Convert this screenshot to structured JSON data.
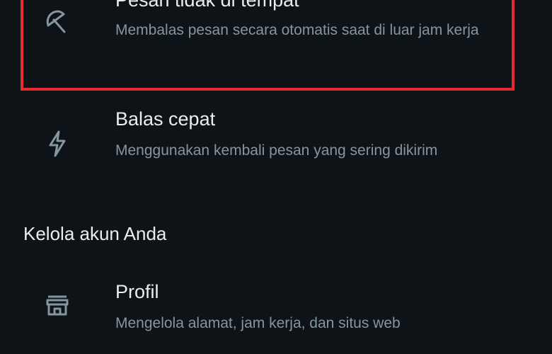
{
  "items": [
    {
      "title": "Pesan tidak di tempat",
      "description": "Membalas pesan secara otomatis saat di luar jam kerja",
      "icon": "umbrella-off-icon",
      "highlighted": true
    },
    {
      "title": "Balas cepat",
      "description": "Menggunakan kembali pesan yang sering dikirim",
      "icon": "lightning-icon"
    }
  ],
  "section": {
    "title": "Kelola akun Anda"
  },
  "account_items": [
    {
      "title": "Profil",
      "description": "Mengelola alamat, jam kerja, dan situs web",
      "icon": "storefront-icon"
    }
  ],
  "colors": {
    "background": "#0d1316",
    "title_text": "#e9edef",
    "secondary_text": "#8696a0",
    "icon": "#8696a0",
    "highlight_border": "#e8292d"
  }
}
